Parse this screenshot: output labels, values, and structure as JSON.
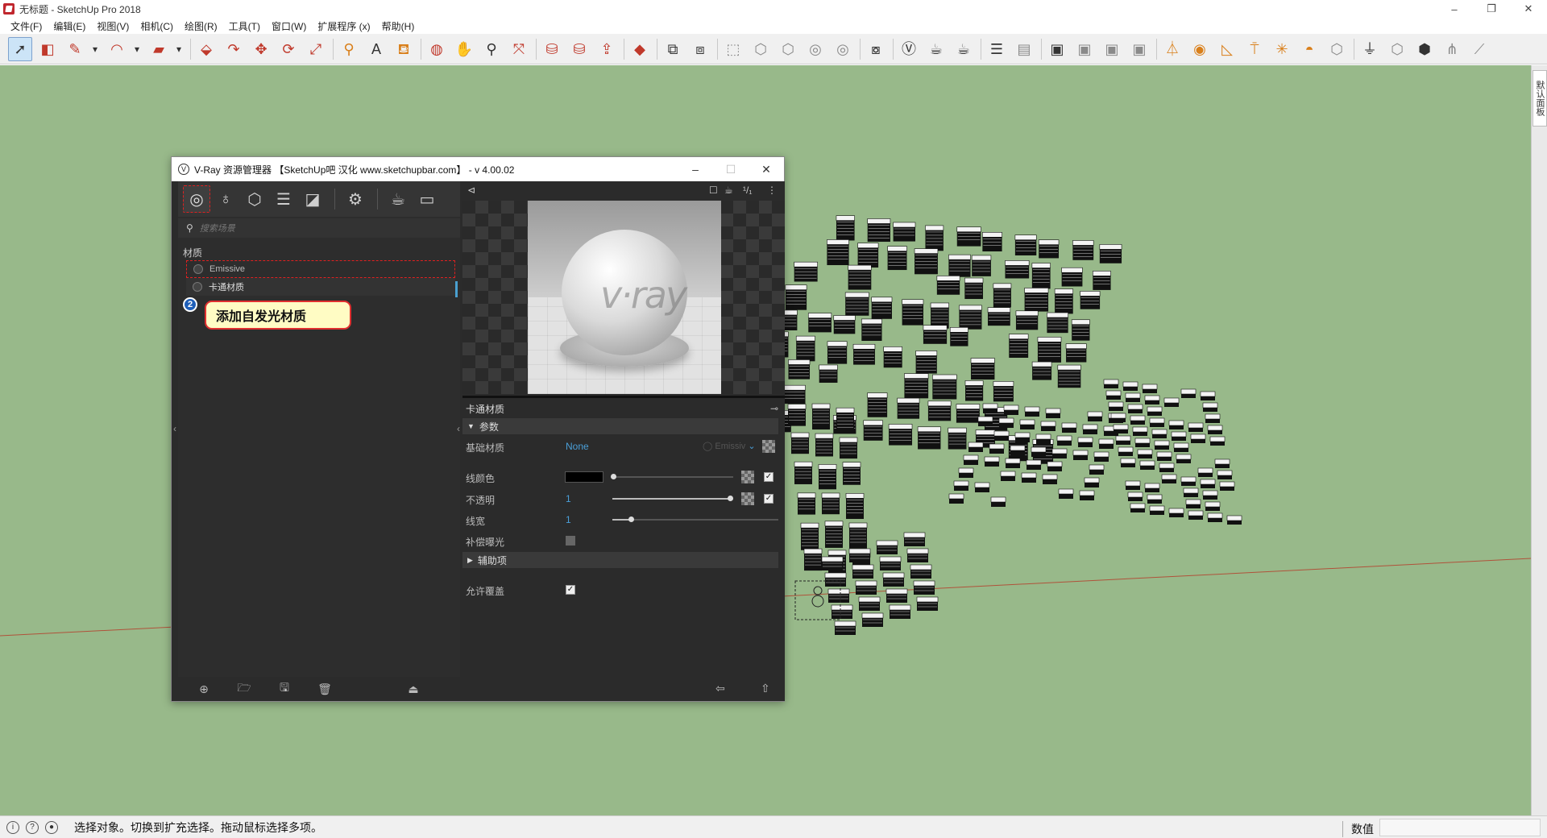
{
  "window": {
    "title": "无标题 - SketchUp Pro 2018",
    "controls": [
      "–",
      "❐",
      "✕"
    ]
  },
  "menu": [
    "文件(F)",
    "编辑(E)",
    "视图(V)",
    "相机(C)",
    "绘图(R)",
    "工具(T)",
    "窗口(W)",
    "扩展程序 (x)",
    "帮助(H)"
  ],
  "toolbar": {
    "tools": [
      {
        "name": "select-tool",
        "glyph": "➚",
        "active": true
      },
      {
        "name": "eraser-tool",
        "glyph": "◧",
        "color": "red"
      },
      {
        "name": "line-tool",
        "glyph": "✎",
        "color": "red"
      },
      {
        "name": "line-dropdown",
        "glyph": "▾"
      },
      {
        "name": "arc-tool",
        "glyph": "◠",
        "color": "red"
      },
      {
        "name": "arc-dropdown",
        "glyph": "▾"
      },
      {
        "name": "rectangle-tool",
        "glyph": "▰",
        "color": "red"
      },
      {
        "name": "rectangle-dropdown",
        "glyph": "▾"
      },
      {
        "name": "sep"
      },
      {
        "name": "push-pull-tool",
        "glyph": "⬙",
        "color": "red"
      },
      {
        "name": "follow-me-tool",
        "glyph": "↷",
        "color": "red"
      },
      {
        "name": "move-tool",
        "glyph": "✥",
        "color": "red"
      },
      {
        "name": "rotate-tool",
        "glyph": "⟳",
        "color": "red"
      },
      {
        "name": "scale-tool",
        "glyph": "⤢",
        "color": "red"
      },
      {
        "name": "sep"
      },
      {
        "name": "tape-measure-tool",
        "glyph": "⚲",
        "color": "orange"
      },
      {
        "name": "text-tool",
        "glyph": "A"
      },
      {
        "name": "paint-bucket-tool",
        "glyph": "⛾",
        "color": "orange"
      },
      {
        "name": "sep"
      },
      {
        "name": "orbit-tool",
        "glyph": "◍",
        "color": "red"
      },
      {
        "name": "pan-tool",
        "glyph": "✋",
        "color": "orange"
      },
      {
        "name": "zoom-tool",
        "glyph": "⚲"
      },
      {
        "name": "zoom-extents-tool",
        "glyph": "⤧",
        "color": "red"
      },
      {
        "name": "sep"
      },
      {
        "name": "warehouse-tool",
        "glyph": "⛁",
        "color": "red"
      },
      {
        "name": "share-model-tool",
        "glyph": "⛁",
        "color": "red"
      },
      {
        "name": "upload-component-tool",
        "glyph": "⇪",
        "color": "red"
      },
      {
        "name": "sep"
      },
      {
        "name": "ruby-tool",
        "glyph": "◆",
        "color": "red"
      },
      {
        "name": "sep"
      },
      {
        "name": "outliner-tool",
        "glyph": "⧉"
      },
      {
        "name": "components-tool",
        "glyph": "⧈"
      },
      {
        "name": "sep"
      },
      {
        "name": "iso-view",
        "glyph": "⬚",
        "color": "gray"
      },
      {
        "name": "top-view",
        "glyph": "⬡",
        "color": "gray"
      },
      {
        "name": "front-view",
        "glyph": "⬡",
        "color": "gray"
      },
      {
        "name": "right-view",
        "glyph": "◎",
        "color": "gray"
      },
      {
        "name": "back-view",
        "glyph": "◎",
        "color": "gray"
      },
      {
        "name": "sep"
      },
      {
        "name": "vray-interactive-tool",
        "glyph": "⧇"
      },
      {
        "name": "sep"
      },
      {
        "name": "vray-logo-tool",
        "glyph": "Ⓥ"
      },
      {
        "name": "vray-render-tool",
        "glyph": "☕"
      },
      {
        "name": "vray-interactive-render-tool",
        "glyph": "☕"
      },
      {
        "name": "sep"
      },
      {
        "name": "vray-frame-buffer-tool",
        "glyph": "☰"
      },
      {
        "name": "vray-batch-render-tool",
        "glyph": "▤",
        "color": "gray"
      },
      {
        "name": "sep"
      },
      {
        "name": "vray-viewport-render-tool",
        "glyph": "▣"
      },
      {
        "name": "vray-region-tool",
        "glyph": "▣",
        "color": "gray"
      },
      {
        "name": "vray-lock-tool",
        "glyph": "▣",
        "color": "gray"
      },
      {
        "name": "vray-cloud-tool",
        "glyph": "▣",
        "color": "gray"
      },
      {
        "name": "sep"
      },
      {
        "name": "vray-rect-light-tool",
        "glyph": "⏃",
        "color": "orange"
      },
      {
        "name": "vray-sphere-light-tool",
        "glyph": "◉",
        "color": "orange"
      },
      {
        "name": "vray-spot-light-tool",
        "glyph": "◺",
        "color": "orange"
      },
      {
        "name": "vray-ies-light-tool",
        "glyph": "⍑",
        "color": "orange"
      },
      {
        "name": "vray-omni-light-tool",
        "glyph": "✳",
        "color": "orange"
      },
      {
        "name": "vray-dome-light-tool",
        "glyph": "◓",
        "color": "orange"
      },
      {
        "name": "vray-mesh-light-tool",
        "glyph": "⬡",
        "color": "gray"
      },
      {
        "name": "sep"
      },
      {
        "name": "vray-infinite-plane-tool",
        "glyph": "⏚"
      },
      {
        "name": "vray-proxy-export-tool",
        "glyph": "⬡",
        "color": "gray"
      },
      {
        "name": "vray-proxy-import-tool",
        "glyph": "⬢"
      },
      {
        "name": "vray-fur-tool",
        "glyph": "⋔",
        "color": "gray"
      },
      {
        "name": "vray-clipper-tool",
        "glyph": "⟋",
        "color": "gray"
      }
    ]
  },
  "tray": {
    "tab_label": "默认面板"
  },
  "vray_editor": {
    "title": "V-Ray 资源管理器 【SketchUp吧 汉化 www.sketchupbar.com】 - v 4.00.02",
    "window_controls": [
      "–",
      "☐",
      "✕"
    ],
    "categories": [
      {
        "name": "materials-category-icon",
        "glyph": "◎",
        "selected": true
      },
      {
        "name": "lights-category-icon",
        "glyph": "♁"
      },
      {
        "name": "geometry-category-icon",
        "glyph": "⬡"
      },
      {
        "name": "render-elements-category-icon",
        "glyph": "☰"
      },
      {
        "name": "textures-category-icon",
        "glyph": "◪"
      },
      {
        "name": "sep"
      },
      {
        "name": "settings-category-icon",
        "glyph": "⚙"
      },
      {
        "name": "sep"
      },
      {
        "name": "render-teapot-icon",
        "glyph": "☕"
      },
      {
        "name": "frame-buffer-icon",
        "glyph": "▭"
      }
    ],
    "search_placeholder": "搜索场景",
    "section_label": "材质",
    "materials": [
      "Emissive",
      "卡通材质"
    ],
    "annotation": {
      "badge": "2",
      "text": "添加自发光材质"
    },
    "bottom_icons": [
      {
        "name": "add-material-icon",
        "glyph": "⊕"
      },
      {
        "name": "open-file-icon",
        "glyph": "🗁"
      },
      {
        "name": "save-file-icon",
        "glyph": "🖫"
      },
      {
        "name": "delete-icon",
        "glyph": "🗑"
      },
      {
        "name": "purge-icon",
        "glyph": "⏏"
      }
    ],
    "preview_toolbar": {
      "pin": "⊲",
      "square": "☐",
      "teapot": "☕",
      "ratio": "¹/₁",
      "more": "⋮"
    },
    "properties": {
      "title": "卡通材质",
      "pin": "⊸",
      "params_label": "参数",
      "base_material_label": "基础材质",
      "base_material_value": "None",
      "base_material_ghost": "Emissiv",
      "line_color_label": "线颜色",
      "line_color": "#000000",
      "opacity_label": "不透明",
      "opacity_value": "1",
      "line_width_label": "线宽",
      "line_width_value": "1",
      "compensate_exposure_label": "补偿曝光",
      "auxiliary_label": "辅助项",
      "allow_override_label": "允许覆盖",
      "checkmark": "✓"
    },
    "right_bottom": {
      "back": "⇦",
      "up": "⇧"
    }
  },
  "status": {
    "message": "选择对象。切换到扩充选择。拖动鼠标选择多项。",
    "measurements_label": "数值",
    "icons": [
      "i",
      "?",
      "●"
    ]
  }
}
